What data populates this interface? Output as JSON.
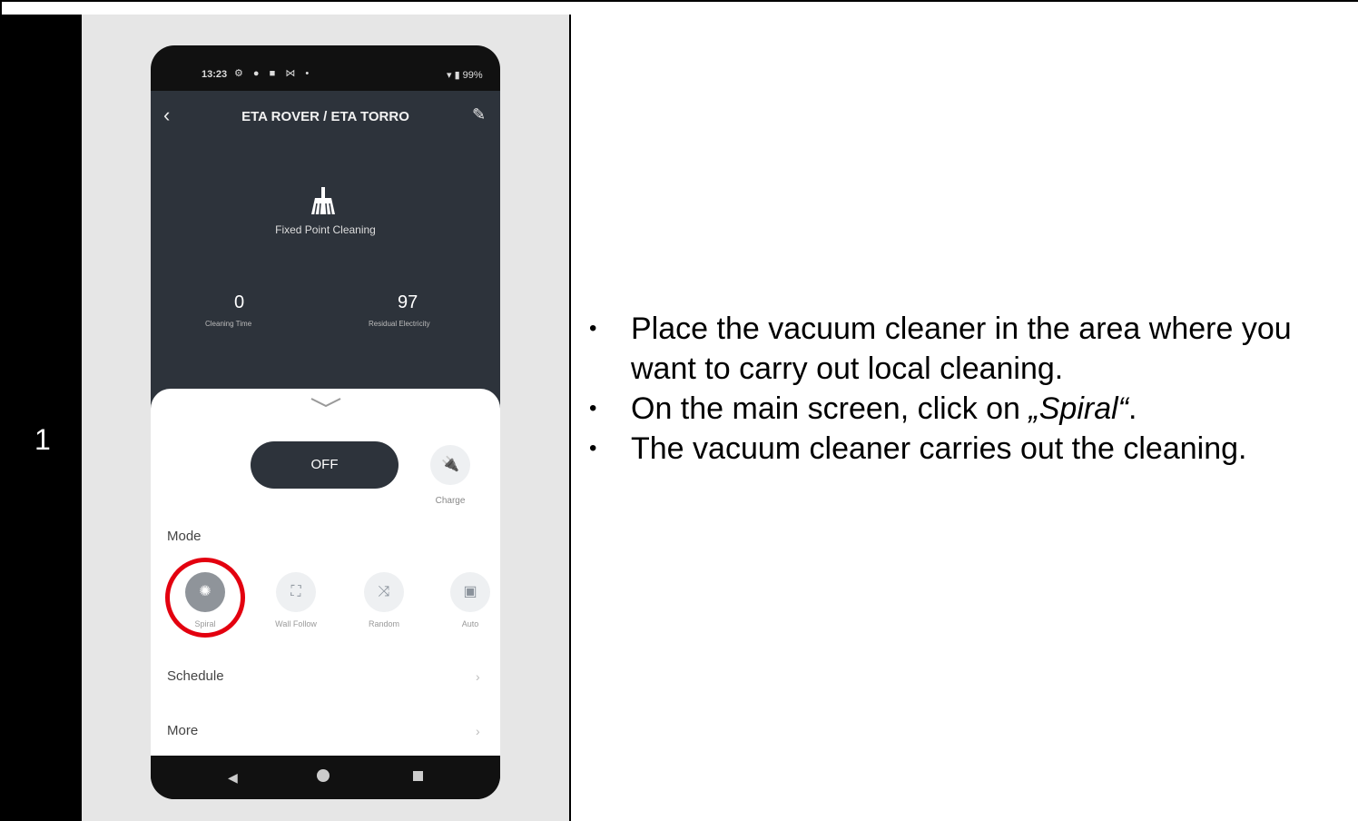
{
  "step": {
    "number": "1"
  },
  "phone": {
    "status_bar": {
      "time": "13:23",
      "icons": "⚙ ● ■ ⋈ •",
      "right": "▾ ▮ 99%"
    },
    "header": {
      "title": "ETA ROVER / ETA TORRO",
      "back_icon": "chevron-left-icon",
      "edit_icon": "pencil-icon"
    },
    "status": {
      "mode_text": "Fixed Point Cleaning"
    },
    "stats": [
      {
        "value": "0",
        "label": "Cleaning Time"
      },
      {
        "value": "97",
        "label": "Residual Electricity"
      }
    ],
    "power": {
      "label": "OFF"
    },
    "charge": {
      "label": "Charge"
    },
    "mode_section": {
      "title": "Mode",
      "modes": [
        {
          "name": "Spiral",
          "icon": "spiral-icon",
          "active": true
        },
        {
          "name": "Wall Follow",
          "icon": "wall-follow-icon",
          "active": false
        },
        {
          "name": "Random",
          "icon": "shuffle-icon",
          "active": false
        },
        {
          "name": "Auto",
          "icon": "auto-icon",
          "active": false
        }
      ]
    },
    "rows": [
      {
        "label": "Schedule"
      },
      {
        "label": "More"
      }
    ]
  },
  "instructions": [
    {
      "text": "Place the vacuum cleaner in the area where you want to carry out local cleaning."
    },
    {
      "prefix": "On the main screen, click on ",
      "emphasis": "„Spiral“",
      "suffix": "."
    },
    {
      "text": "The vacuum cleaner carries out the cleaning."
    }
  ],
  "colors": {
    "highlight": "#e3000f",
    "app_dark": "#2d333b"
  }
}
